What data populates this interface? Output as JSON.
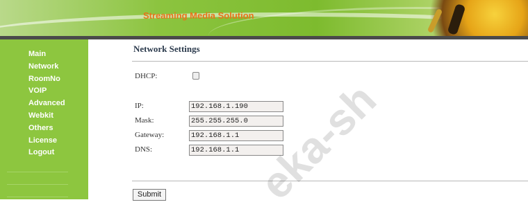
{
  "banner": {
    "title": "Streaming Media Solution"
  },
  "sidebar": {
    "items": [
      {
        "label": "Main"
      },
      {
        "label": "Network"
      },
      {
        "label": "RoomNo"
      },
      {
        "label": "VOIP"
      },
      {
        "label": "Advanced"
      },
      {
        "label": "Webkit"
      },
      {
        "label": "Others"
      },
      {
        "label": "License"
      },
      {
        "label": "Logout"
      }
    ]
  },
  "main": {
    "title": "Network Settings",
    "dhcp_label": "DHCP:",
    "dhcp_checked": false,
    "fields": [
      {
        "label": "IP:",
        "value": "192.168.1.190"
      },
      {
        "label": "Mask:",
        "value": "255.255.255.0"
      },
      {
        "label": "Gateway:",
        "value": "192.168.1.1"
      },
      {
        "label": "DNS:",
        "value": "192.168.1.1"
      }
    ],
    "submit_label": "Submit"
  },
  "watermark": {
    "text": "eka-sh"
  },
  "colors": {
    "sidebar": "#8dc63f",
    "accent_title": "#e8731a"
  }
}
